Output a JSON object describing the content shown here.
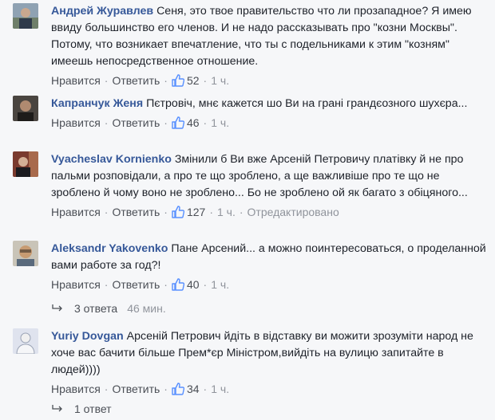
{
  "labels": {
    "like": "Нравится",
    "reply": "Ответить",
    "dot": "·"
  },
  "comments": [
    {
      "author": "Андрей Журавлев",
      "text": "Сеня, это твое правительство что ли прозападное? Я имею ввиду большинство его членов. И не надо рассказывать про \"козни Москвы\". Потому, что возникает впечатление, что ты с подельниками к этим \"козням\" имеешь непосредственное отношение.",
      "likes": "52",
      "time": "1 ч.",
      "edited": ""
    },
    {
      "author": "Капранчук Женя",
      "text": "Пєтровіч, мнє кажется шо Ви на грані грандєозного шухєра...",
      "likes": "46",
      "time": "1 ч.",
      "edited": ""
    },
    {
      "author": "Vyacheslav Kornienko",
      "text": "Змінили б Ви вже Арсеній Петровичу платівку й не про пальми розповідали, а про те що зроблено, а ще важливіше про те що не зроблено й чому воно не зроблено... Бо не зроблено ой як багато з обіцяного...",
      "likes": "127",
      "time": "1 ч.",
      "edited": "Отредактировано"
    },
    {
      "author": "Aleksandr Yakovenko",
      "text": "Пане Арсений... а можно поинтересоваться, о проделанной вами работе за год?!",
      "likes": "40",
      "time": "1 ч.",
      "edited": ""
    },
    {
      "author": "Yuriy Dovgan",
      "text": "Арсеній Петрович йдіть в відставку ви можити зрозуміти народ не хоче вас бачити більше Прем*єр Міністром,вийдіть на вулицю запитайте в людей))))",
      "likes": "34",
      "time": "1 ч.",
      "edited": ""
    }
  ],
  "replies": [
    {
      "label": "3 ответа",
      "time": "46 мин."
    },
    {
      "label": "1 ответ",
      "time": ""
    }
  ],
  "colors": {
    "author": "#365899",
    "meta": "#90949c",
    "link": "#4b4f56",
    "background": "#f6f7f9"
  }
}
